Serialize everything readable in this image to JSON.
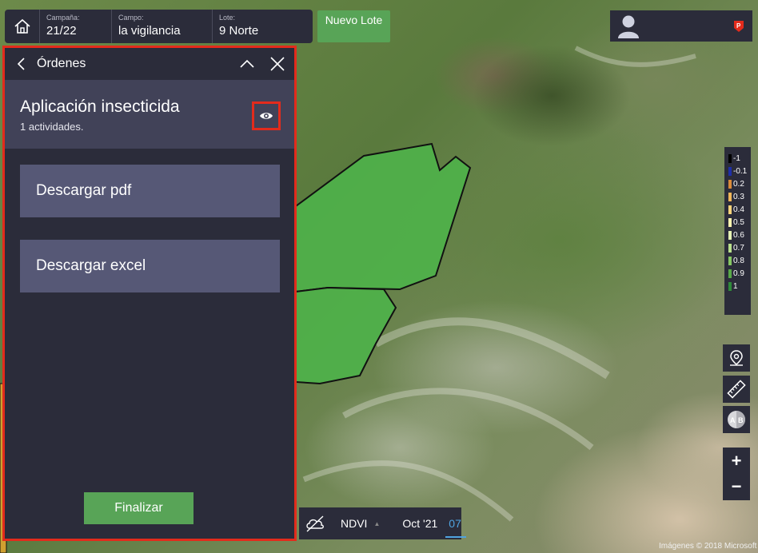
{
  "topbar": {
    "campaign_label": "Campaña:",
    "campaign_value": "21/22",
    "field_label": "Campo:",
    "field_value": "la vigilancia",
    "lot_label": "Lote:",
    "lot_value": "9 Norte",
    "new_lot_button": "Nuevo Lote"
  },
  "panel": {
    "title": "Órdenes",
    "order_name": "Aplicación insecticida",
    "activity_count": "1 actividades.",
    "download_pdf": "Descargar pdf",
    "download_excel": "Descargar excel",
    "finish_button": "Finalizar"
  },
  "legend": [
    {
      "value": "-1",
      "color": "#000000"
    },
    {
      "value": "-0.1",
      "color": "#1f2fa8"
    },
    {
      "value": "0.2",
      "color": "#d98a3a"
    },
    {
      "value": "0.3",
      "color": "#f0b65a"
    },
    {
      "value": "0.4",
      "color": "#f5d27a"
    },
    {
      "value": "0.5",
      "color": "#fbf3b0"
    },
    {
      "value": "0.6",
      "color": "#e4f0b4"
    },
    {
      "value": "0.7",
      "color": "#b9df8c"
    },
    {
      "value": "0.8",
      "color": "#86c664"
    },
    {
      "value": "0.9",
      "color": "#58a848"
    },
    {
      "value": "1",
      "color": "#2e8a3a"
    }
  ],
  "bottombar": {
    "layer": "NDVI",
    "date": "Oct '21",
    "day": "07"
  },
  "map_credits": "Imágenes © 2018 Microsoft",
  "icons": {
    "home": "home-icon",
    "back": "chevron-left-icon",
    "collapse": "chevron-up-icon",
    "close": "close-icon",
    "eye": "eye-icon",
    "avatar": "user-avatar-icon",
    "badge": "brand-badge-icon",
    "location": "location-pin-icon",
    "ruler": "ruler-icon",
    "compare": "ab-compare-icon",
    "cloud": "cloud-off-icon"
  },
  "colors": {
    "panel_bg": "#2b2c3a",
    "accent_green": "#58a457",
    "highlight_red": "#e32b1c",
    "day_blue": "#4fa3e0"
  }
}
